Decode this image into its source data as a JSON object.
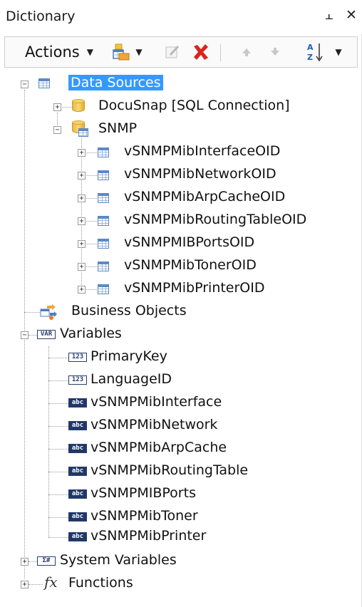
{
  "panel": {
    "title": "Dictionary",
    "pin_glyph": "⫠",
    "close_glyph": "✕"
  },
  "toolbar": {
    "actions_label": "Actions",
    "caret": "▼",
    "sort_label": "A/Z",
    "icons": [
      "new-item-icon",
      "edit-icon",
      "delete-icon",
      "move-up-icon",
      "move-down-icon",
      "sort-az-icon"
    ]
  },
  "tree": {
    "data_sources": {
      "label": "Data Sources",
      "children": [
        {
          "label": "DocuSnap [SQL Connection]"
        },
        {
          "label": "SNMP",
          "children": [
            {
              "label": "vSNMPMibInterfaceOID"
            },
            {
              "label": "vSNMPMibNetworkOID"
            },
            {
              "label": "vSNMPMibArpCacheOID"
            },
            {
              "label": "vSNMPMibRoutingTableOID"
            },
            {
              "label": "vSNMPMIBPortsOID"
            },
            {
              "label": "vSNMPMibTonerOID"
            },
            {
              "label": "vSNMPMibPrinterOID"
            }
          ]
        }
      ]
    },
    "business_objects": {
      "label": "Business Objects"
    },
    "variables": {
      "label": "Variables",
      "badge": "VAR",
      "items": [
        {
          "label": "PrimaryKey",
          "badge": "123"
        },
        {
          "label": "LanguageID",
          "badge": "123"
        },
        {
          "label": "vSNMPMibInterface",
          "badge": "abc"
        },
        {
          "label": "vSNMPMibNetwork",
          "badge": "abc"
        },
        {
          "label": "vSNMPMibArpCache",
          "badge": "abc"
        },
        {
          "label": "vSNMPMibRoutingTable",
          "badge": "abc"
        },
        {
          "label": "vSNMPMIBPorts",
          "badge": "abc"
        },
        {
          "label": "vSNMPMibToner",
          "badge": "abc"
        },
        {
          "label": "vSNMPMibPrinter",
          "badge": "abc"
        }
      ]
    },
    "system_variables": {
      "label": "System Variables",
      "badge": "Σ#"
    },
    "functions": {
      "label": "Functions",
      "badge": "fx"
    }
  },
  "colors": {
    "selection": "#3399ff",
    "delete_red": "#d9261c",
    "var_badge": "#1f3768"
  }
}
